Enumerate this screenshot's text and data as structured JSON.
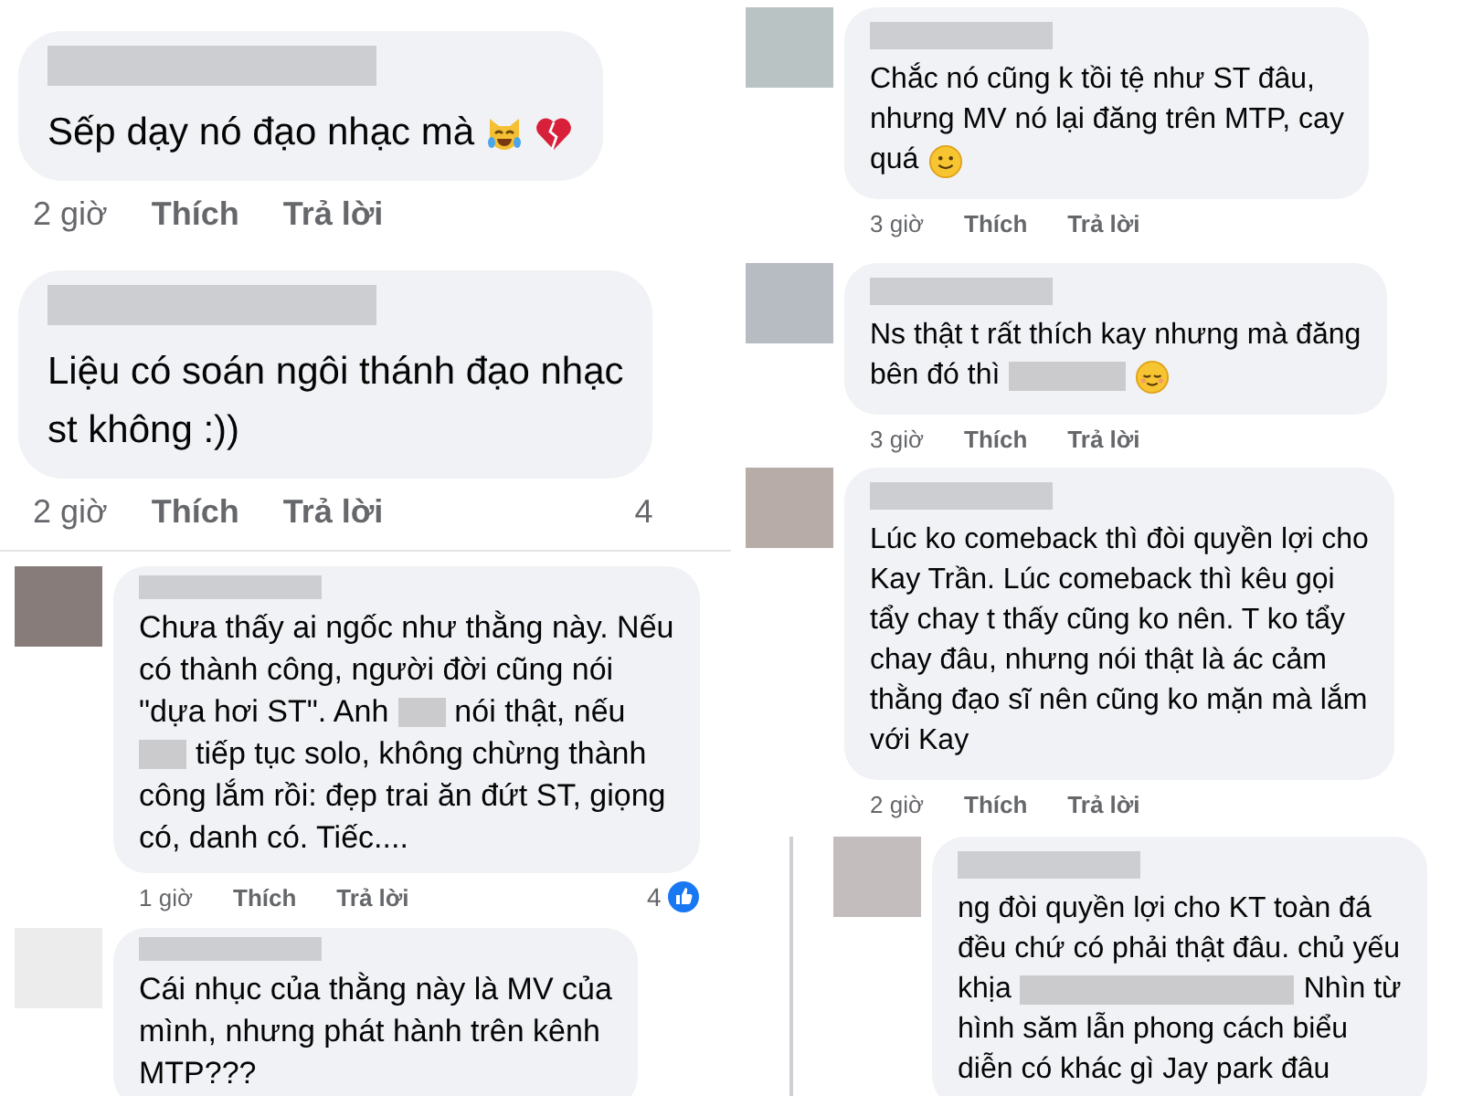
{
  "columns": [
    {
      "panels": [
        {
          "kind": "mobile",
          "comments": [
            {
              "avatar": false,
              "body": [
                [
                  {
                    "kind": "text",
                    "text": "Sếp dạy nó đạo nhạc mà"
                  },
                  {
                    "kind": "cat-emoji"
                  },
                  {
                    "kind": "heart-emoji"
                  }
                ]
              ],
              "time": "2 giờ",
              "like": "Thích",
              "reply": "Trả lời"
            },
            {
              "avatar": false,
              "body": [
                [
                  {
                    "kind": "text",
                    "text": "Liệu có soán ngôi thánh đạo nhạc"
                  }
                ],
                [
                  {
                    "kind": "text",
                    "text": "st không :))"
                  }
                ]
              ],
              "time": "2 giờ",
              "like": "Thích",
              "reply": "Trả lời",
              "reaction_count": "4"
            }
          ]
        },
        {
          "kind": "desktop-alt",
          "comments": [
            {
              "avatar": true,
              "body": [
                [
                  {
                    "kind": "text",
                    "text": "Chưa thấy ai ngốc như thằng này. Nếu"
                  }
                ],
                [
                  {
                    "kind": "text",
                    "text": "có thành công, người đời cũng nói"
                  }
                ],
                [
                  {
                    "kind": "text",
                    "text": "\"dựa hơi ST\". Anh"
                  },
                  {
                    "kind": "blur-short"
                  },
                  {
                    "kind": "text",
                    "text": "nói thật, nếu"
                  }
                ],
                [
                  {
                    "kind": "blur-short"
                  },
                  {
                    "kind": "text",
                    "text": "tiếp tục solo, không chừng thành"
                  }
                ],
                [
                  {
                    "kind": "text",
                    "text": "công lắm rồi: đẹp trai ăn đứt ST, giọng"
                  }
                ],
                [
                  {
                    "kind": "text",
                    "text": "có, danh có. Tiếc...."
                  }
                ]
              ],
              "time": "1 giờ",
              "like": "Thích",
              "reply": "Trả lời",
              "reaction_count": "4",
              "reaction_icon": true
            },
            {
              "avatar": true,
              "body": [
                [
                  {
                    "kind": "text",
                    "text": "Cái nhục của thằng này là MV của"
                  }
                ],
                [
                  {
                    "kind": "text",
                    "text": "mình, nhưng phát hành trên kênh"
                  }
                ],
                [
                  {
                    "kind": "text",
                    "text": "MTP???"
                  }
                ]
              ]
            }
          ]
        }
      ]
    },
    {
      "panels": [
        {
          "kind": "desktop",
          "comments": [
            {
              "avatar": true,
              "body": [
                [
                  {
                    "kind": "text",
                    "text": "Chắc nó cũng k tồi tệ như ST đâu,"
                  }
                ],
                [
                  {
                    "kind": "text",
                    "text": "nhưng MV nó lại đăng trên MTP, cay"
                  }
                ],
                [
                  {
                    "kind": "text",
                    "text": "quá"
                  },
                  {
                    "kind": "smile-emoji"
                  }
                ]
              ],
              "time": "3 giờ",
              "like": "Thích",
              "reply": "Trả lời"
            },
            {
              "avatar": true,
              "body": [
                [
                  {
                    "kind": "text",
                    "text": "Ns thật t rất thích kay nhưng mà đăng"
                  }
                ],
                [
                  {
                    "kind": "text",
                    "text": "bên đó thì"
                  },
                  {
                    "kind": "blur-medium"
                  },
                  {
                    "kind": "relieved-emoji"
                  }
                ]
              ],
              "time": "3 giờ",
              "like": "Thích",
              "reply": "Trả lời"
            }
          ]
        },
        {
          "kind": "desktop",
          "comments": [
            {
              "avatar": true,
              "body": [
                [
                  {
                    "kind": "text",
                    "text": "Lúc ko comeback thì đòi quyền lợi cho"
                  }
                ],
                [
                  {
                    "kind": "text",
                    "text": "Kay Trần. Lúc comeback thì kêu gọi"
                  }
                ],
                [
                  {
                    "kind": "text",
                    "text": "tẩy chay t thấy cũng ko nên. T ko tẩy"
                  }
                ],
                [
                  {
                    "kind": "text",
                    "text": "chay đâu, nhưng nói thật là ác cảm"
                  }
                ],
                [
                  {
                    "kind": "text",
                    "text": "thằng đạo sĩ nên cũng ko mặn mà lắm"
                  }
                ],
                [
                  {
                    "kind": "text",
                    "text": "với Kay"
                  }
                ]
              ],
              "time": "2 giờ",
              "like": "Thích",
              "reply": "Trả lời",
              "children": [
                {
                  "avatar": true,
                  "body": [
                    [
                      {
                        "kind": "text",
                        "text": "ng đòi quyền lợi cho KT toàn đá"
                      }
                    ],
                    [
                      {
                        "kind": "text",
                        "text": "đều chứ có phải thật đâu. chủ yếu"
                      }
                    ],
                    [
                      {
                        "kind": "text",
                        "text": "khịa"
                      },
                      {
                        "kind": "blur-long"
                      },
                      {
                        "kind": "text",
                        "text": "Nhìn từ"
                      }
                    ],
                    [
                      {
                        "kind": "text",
                        "text": "hình săm lẫn phong cách biểu"
                      }
                    ],
                    [
                      {
                        "kind": "text",
                        "text": "diễn có khác gì Jay park đâu"
                      }
                    ]
                  ]
                }
              ]
            }
          ]
        }
      ]
    }
  ]
}
